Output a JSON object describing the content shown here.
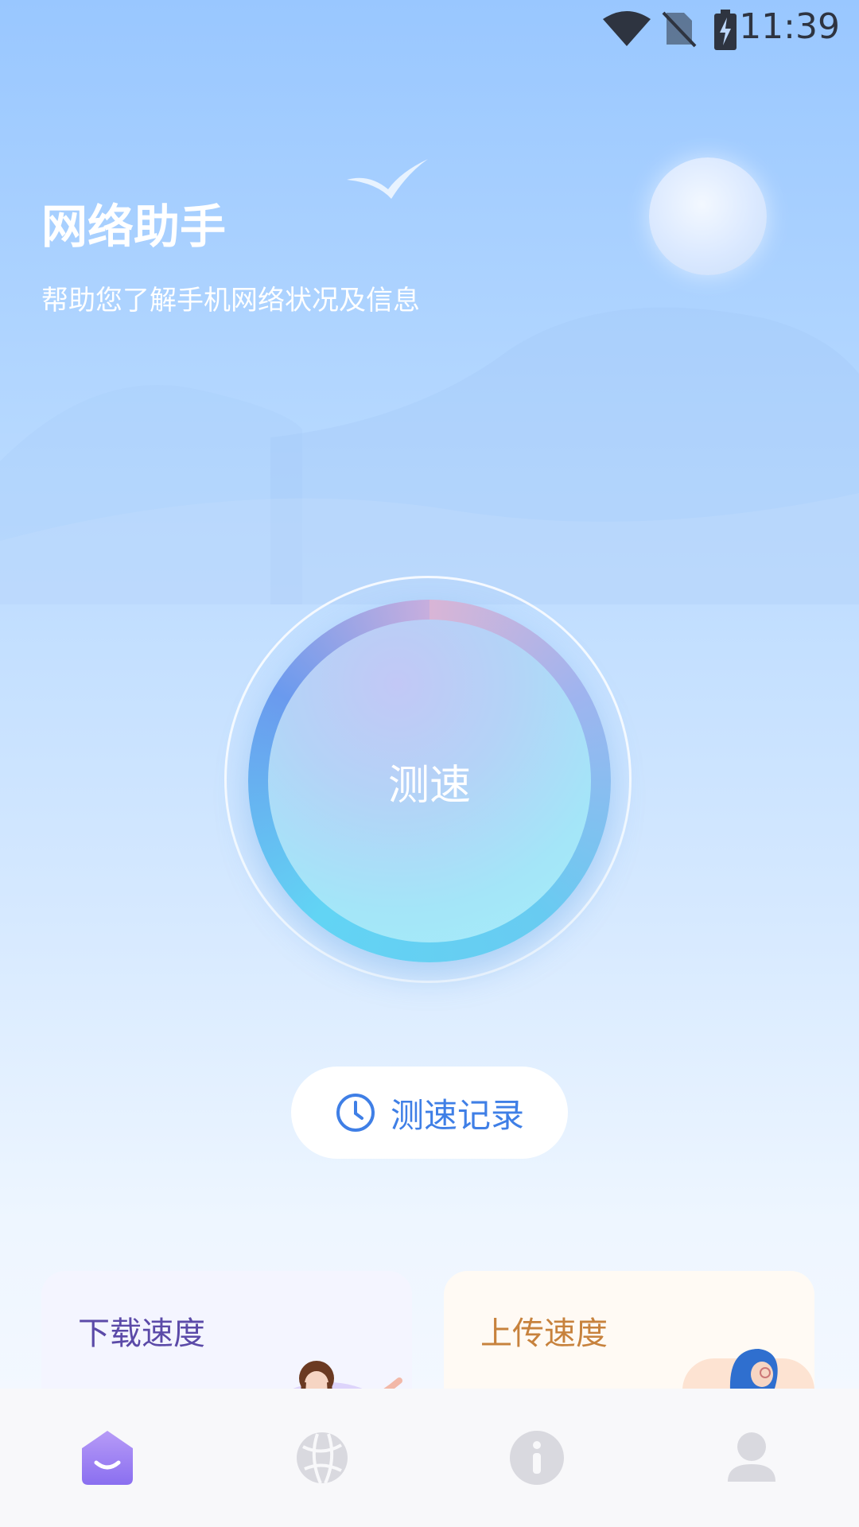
{
  "status_bar": {
    "time": "11:39"
  },
  "header": {
    "title": "网络助手",
    "subtitle": "帮助您了解手机网络状况及信息"
  },
  "speed_test": {
    "button_label": "测速"
  },
  "history": {
    "label": "测速记录"
  },
  "cards": {
    "download_title": "下载速度",
    "upload_title": "上传速度"
  },
  "tabs": [
    {
      "name": "home",
      "icon": "home-icon",
      "active": true
    },
    {
      "name": "network",
      "icon": "globe-icon",
      "active": false
    },
    {
      "name": "info",
      "icon": "info-icon",
      "active": false
    },
    {
      "name": "profile",
      "icon": "user-icon",
      "active": false
    }
  ],
  "colors": {
    "accent_blue": "#3f7fe6",
    "download_title": "#5b4aa8",
    "upload_title": "#c7823d",
    "home_tab": "#9a7bf0"
  }
}
